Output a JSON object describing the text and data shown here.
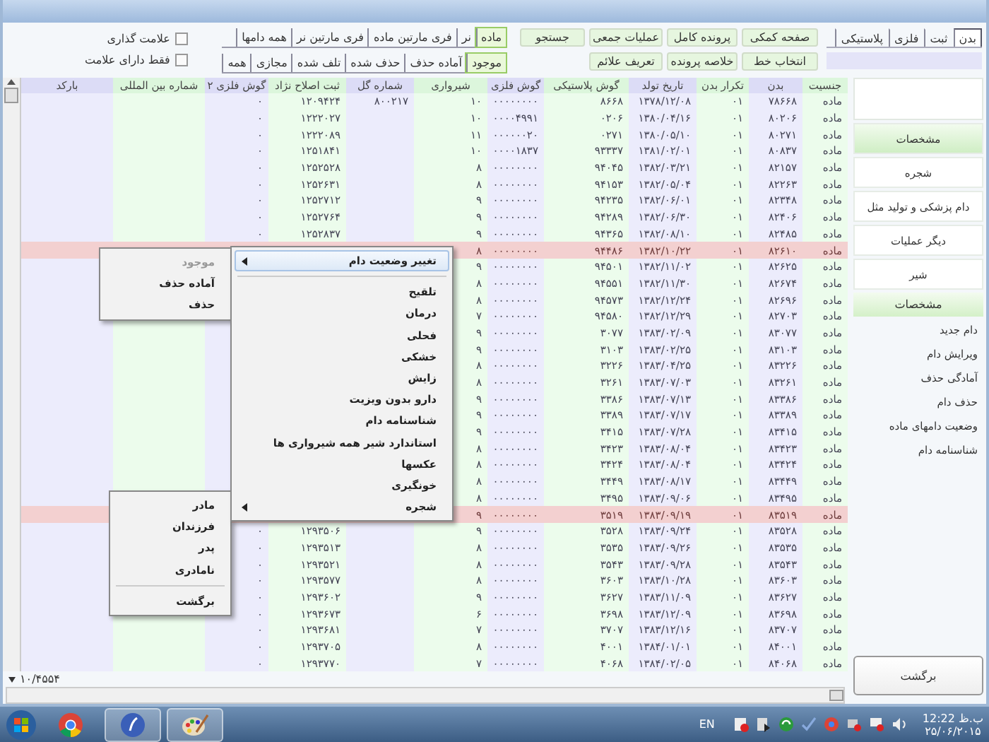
{
  "toolbar": {
    "id_tabs": [
      {
        "label": "بدن",
        "selected": true
      },
      {
        "label": "ثبت",
        "selected": false
      },
      {
        "label": "فلزی",
        "selected": false
      },
      {
        "label": "پلاستیکی",
        "selected": false
      }
    ],
    "buttons": [
      "صفحه کمکی",
      "پرونده کامل",
      "عملیات جمعی",
      "جستجو",
      "انتخاب خط",
      "خلاصه پرونده",
      "تعریف علائم"
    ],
    "sex_filter": [
      {
        "label": "ماده",
        "selected": true
      },
      {
        "label": "نر",
        "selected": false
      },
      {
        "label": "فری مارتین ماده",
        "selected": false
      },
      {
        "label": "فری مارتین نر",
        "selected": false
      },
      {
        "label": "همه دامها",
        "selected": false
      }
    ],
    "status_filter": [
      {
        "label": "موجود",
        "selected": true
      },
      {
        "label": "آماده حذف",
        "selected": false
      },
      {
        "label": "حذف شده",
        "selected": false
      },
      {
        "label": "تلف شده",
        "selected": false
      },
      {
        "label": "مجازی",
        "selected": false
      },
      {
        "label": "همه",
        "selected": false
      }
    ],
    "checkboxes": [
      {
        "label": "علامت گذاری",
        "checked": false
      },
      {
        "label": "فقط دارای علامت",
        "checked": false
      }
    ]
  },
  "table": {
    "columns": [
      "جنسیت",
      "بدن",
      "تکرار بدن",
      "تاریخ تولد",
      "گوش پلاستیکی",
      "گوش فلزی",
      "شیرواری",
      "شماره گل",
      "ثبت اصلاح نژاد",
      "گوش فلزی ۲",
      "شماره بین المللی",
      "بارکد"
    ],
    "rows": [
      {
        "selected": false,
        "sex": "ماده",
        "body": "۷۸۶۶۸",
        "repeat": "۰۱",
        "birth": "۱۳۷۸/۱۲/۰۸",
        "plastic": "۸۶۶۸",
        "metal": "۰۰۰۰۰۰۰۰",
        "milking": "۱۰",
        "herd": "۸۰۰۲۱۷",
        "register": "۱۲۰۹۴۲۴",
        "metal2": "۰"
      },
      {
        "selected": false,
        "sex": "ماده",
        "body": "۸۰۲۰۶",
        "repeat": "۰۱",
        "birth": "۱۳۸۰/۰۴/۱۶",
        "plastic": "۰۲۰۶",
        "metal": "۰۰۰۰۴۹۹۱",
        "milking": "۱۰",
        "register": "۱۲۲۲۰۲۷",
        "metal2": "۰"
      },
      {
        "selected": false,
        "sex": "ماده",
        "body": "۸۰۲۷۱",
        "repeat": "۰۱",
        "birth": "۱۳۸۰/۰۵/۱۰",
        "plastic": "۰۲۷۱",
        "metal": "۰۰۰۰۰۰۲۰",
        "milking": "۱۱",
        "register": "۱۲۲۲۰۸۹",
        "metal2": "۰"
      },
      {
        "selected": false,
        "sex": "ماده",
        "body": "۸۰۸۳۷",
        "repeat": "۰۱",
        "birth": "۱۳۸۱/۰۲/۰۱",
        "plastic": "۹۳۳۳۷",
        "metal": "۰۰۰۰۱۸۳۷",
        "milking": "۱۰",
        "register": "۱۲۵۱۸۴۱",
        "metal2": "۰"
      },
      {
        "selected": false,
        "sex": "ماده",
        "body": "۸۲۱۵۷",
        "repeat": "۰۱",
        "birth": "۱۳۸۲/۰۳/۲۱",
        "plastic": "۹۴۰۴۵",
        "metal": "۰۰۰۰۰۰۰۰",
        "milking": "۸",
        "register": "۱۲۵۲۵۲۸",
        "metal2": "۰"
      },
      {
        "selected": false,
        "sex": "ماده",
        "body": "۸۲۲۶۳",
        "repeat": "۰۱",
        "birth": "۱۳۸۲/۰۵/۰۴",
        "plastic": "۹۴۱۵۳",
        "metal": "۰۰۰۰۰۰۰۰",
        "milking": "۸",
        "register": "۱۲۵۲۶۳۱",
        "metal2": "۰"
      },
      {
        "selected": false,
        "sex": "ماده",
        "body": "۸۲۳۴۸",
        "repeat": "۰۱",
        "birth": "۱۳۸۲/۰۶/۰۱",
        "plastic": "۹۴۲۳۵",
        "metal": "۰۰۰۰۰۰۰۰",
        "milking": "۹",
        "register": "۱۲۵۲۷۱۲",
        "metal2": "۰"
      },
      {
        "selected": false,
        "sex": "ماده",
        "body": "۸۲۴۰۶",
        "repeat": "۰۱",
        "birth": "۱۳۸۲/۰۶/۳۰",
        "plastic": "۹۴۲۸۹",
        "metal": "۰۰۰۰۰۰۰۰",
        "milking": "۹",
        "register": "۱۲۵۲۷۶۴",
        "metal2": "۰"
      },
      {
        "selected": false,
        "sex": "ماده",
        "body": "۸۲۴۸۵",
        "repeat": "۰۱",
        "birth": "۱۳۸۲/۰۸/۱۰",
        "plastic": "۹۴۳۶۵",
        "metal": "۰۰۰۰۰۰۰۰",
        "milking": "۹",
        "register": "۱۲۵۲۸۳۷",
        "metal2": "۰"
      },
      {
        "selected": true,
        "sex": "ماده",
        "body": "۸۲۶۱۰",
        "repeat": "۰۱",
        "birth": "۱۳۸۲/۱۰/۲۲",
        "plastic": "۹۴۴۸۶",
        "metal": "۰۰۰۰۰۰۰۰",
        "milking": "۸"
      },
      {
        "selected": false,
        "sex": "ماده",
        "body": "۸۲۶۲۵",
        "repeat": "۰۱",
        "birth": "۱۳۸۲/۱۱/۰۲",
        "plastic": "۹۴۵۰۱",
        "metal": "۰۰۰۰۰۰۰۰",
        "milking": "۹"
      },
      {
        "selected": false,
        "sex": "ماده",
        "body": "۸۲۶۷۴",
        "repeat": "۰۱",
        "birth": "۱۳۸۲/۱۱/۳۰",
        "plastic": "۹۴۵۵۱",
        "metal": "۰۰۰۰۰۰۰۰",
        "milking": "۸"
      },
      {
        "selected": false,
        "sex": "ماده",
        "body": "۸۲۶۹۶",
        "repeat": "۰۱",
        "birth": "۱۳۸۲/۱۲/۲۴",
        "plastic": "۹۴۵۷۳",
        "metal": "۰۰۰۰۰۰۰۰",
        "milking": "۸"
      },
      {
        "selected": false,
        "sex": "ماده",
        "body": "۸۲۷۰۳",
        "repeat": "۰۱",
        "birth": "۱۳۸۲/۱۲/۲۹",
        "plastic": "۹۴۵۸۰",
        "metal": "۰۰۰۰۰۰۰۰",
        "milking": "۷"
      },
      {
        "selected": false,
        "sex": "ماده",
        "body": "۸۳۰۷۷",
        "repeat": "۰۱",
        "birth": "۱۳۸۳/۰۲/۰۹",
        "plastic": "۳۰۷۷",
        "metal": "۰۰۰۰۰۰۰۰",
        "milking": "۹"
      },
      {
        "selected": false,
        "sex": "ماده",
        "body": "۸۳۱۰۳",
        "repeat": "۰۱",
        "birth": "۱۳۸۳/۰۲/۲۵",
        "plastic": "۳۱۰۳",
        "metal": "۰۰۰۰۰۰۰۰",
        "milking": "۹"
      },
      {
        "selected": false,
        "sex": "ماده",
        "body": "۸۳۲۲۶",
        "repeat": "۰۱",
        "birth": "۱۳۸۳/۰۴/۲۵",
        "plastic": "۳۲۲۶",
        "metal": "۰۰۰۰۰۰۰۰",
        "milking": "۸"
      },
      {
        "selected": false,
        "sex": "ماده",
        "body": "۸۳۲۶۱",
        "repeat": "۰۱",
        "birth": "۱۳۸۳/۰۷/۰۳",
        "plastic": "۳۲۶۱",
        "metal": "۰۰۰۰۰۰۰۰",
        "milking": "۸"
      },
      {
        "selected": false,
        "sex": "ماده",
        "body": "۸۳۳۸۶",
        "repeat": "۰۱",
        "birth": "۱۳۸۳/۰۷/۱۳",
        "plastic": "۳۳۸۶",
        "metal": "۰۰۰۰۰۰۰۰",
        "milking": "۹"
      },
      {
        "selected": false,
        "sex": "ماده",
        "body": "۸۳۳۸۹",
        "repeat": "۰۱",
        "birth": "۱۳۸۳/۰۷/۱۷",
        "plastic": "۳۳۸۹",
        "metal": "۰۰۰۰۰۰۰۰",
        "milking": "۹"
      },
      {
        "selected": false,
        "sex": "ماده",
        "body": "۸۳۴۱۵",
        "repeat": "۰۱",
        "birth": "۱۳۸۳/۰۷/۲۸",
        "plastic": "۳۴۱۵",
        "metal": "۰۰۰۰۰۰۰۰",
        "milking": "۹"
      },
      {
        "selected": false,
        "sex": "ماده",
        "body": "۸۳۴۲۳",
        "repeat": "۰۱",
        "birth": "۱۳۸۳/۰۸/۰۴",
        "plastic": "۳۴۲۳",
        "metal": "۰۰۰۰۰۰۰۰",
        "milking": "۸"
      },
      {
        "selected": false,
        "sex": "ماده",
        "body": "۸۳۴۲۴",
        "repeat": "۰۱",
        "birth": "۱۳۸۳/۰۸/۰۴",
        "plastic": "۳۴۲۴",
        "metal": "۰۰۰۰۰۰۰۰",
        "milking": "۸"
      },
      {
        "selected": false,
        "sex": "ماده",
        "body": "۸۳۴۴۹",
        "repeat": "۰۱",
        "birth": "۱۳۸۳/۰۸/۱۷",
        "plastic": "۳۴۴۹",
        "metal": "۰۰۰۰۰۰۰۰",
        "milking": "۸"
      },
      {
        "selected": false,
        "sex": "ماده",
        "body": "۸۳۴۹۵",
        "repeat": "۰۱",
        "birth": "۱۳۸۳/۰۹/۰۶",
        "plastic": "۳۴۹۵",
        "metal": "۰۰۰۰۰۰۰۰",
        "milking": "۸"
      },
      {
        "selected": true,
        "sex": "ماده",
        "body": "۸۳۵۱۹",
        "repeat": "۰۱",
        "birth": "۱۳۸۳/۰۹/۱۹",
        "plastic": "۳۵۱۹",
        "metal": "۰۰۰۰۰۰۰۰",
        "milking": "۹"
      },
      {
        "selected": false,
        "sex": "ماده",
        "body": "۸۳۵۲۸",
        "repeat": "۰۱",
        "birth": "۱۳۸۳/۰۹/۲۴",
        "plastic": "۳۵۲۸",
        "metal": "۰۰۰۰۰۰۰۰",
        "milking": "۹",
        "register": "۱۲۹۳۵۰۶",
        "metal2": "۰"
      },
      {
        "selected": false,
        "sex": "ماده",
        "body": "۸۳۵۳۵",
        "repeat": "۰۱",
        "birth": "۱۳۸۳/۰۹/۲۶",
        "plastic": "۳۵۳۵",
        "metal": "۰۰۰۰۰۰۰۰",
        "milking": "۸",
        "register": "۱۲۹۳۵۱۳",
        "metal2": "۰"
      },
      {
        "selected": false,
        "sex": "ماده",
        "body": "۸۳۵۴۳",
        "repeat": "۰۱",
        "birth": "۱۳۸۳/۰۹/۲۸",
        "plastic": "۳۵۴۳",
        "metal": "۰۰۰۰۰۰۰۰",
        "milking": "۸",
        "register": "۱۲۹۳۵۲۱",
        "metal2": "۰"
      },
      {
        "selected": false,
        "sex": "ماده",
        "body": "۸۳۶۰۳",
        "repeat": "۰۱",
        "birth": "۱۳۸۳/۱۰/۲۸",
        "plastic": "۳۶۰۳",
        "metal": "۰۰۰۰۰۰۰۰",
        "milking": "۸",
        "register": "۱۲۹۳۵۷۷",
        "metal2": "۰"
      },
      {
        "selected": false,
        "sex": "ماده",
        "body": "۸۳۶۲۷",
        "repeat": "۰۱",
        "birth": "۱۳۸۳/۱۱/۰۹",
        "plastic": "۳۶۲۷",
        "metal": "۰۰۰۰۰۰۰۰",
        "milking": "۹",
        "register": "۱۲۹۳۶۰۲",
        "metal2": "۰"
      },
      {
        "selected": false,
        "sex": "ماده",
        "body": "۸۳۶۹۸",
        "repeat": "۰۱",
        "birth": "۱۳۸۳/۱۲/۰۹",
        "plastic": "۳۶۹۸",
        "metal": "۰۰۰۰۰۰۰۰",
        "milking": "۶",
        "register": "۱۲۹۳۶۷۳",
        "metal2": "۰"
      },
      {
        "selected": false,
        "sex": "ماده",
        "body": "۸۳۷۰۷",
        "repeat": "۰۱",
        "birth": "۱۳۸۳/۱۲/۱۶",
        "plastic": "۳۷۰۷",
        "metal": "۰۰۰۰۰۰۰۰",
        "milking": "۷",
        "register": "۱۲۹۳۶۸۱",
        "metal2": "۰"
      },
      {
        "selected": false,
        "sex": "ماده",
        "body": "۸۴۰۰۱",
        "repeat": "۰۱",
        "birth": "۱۳۸۴/۰۱/۰۱",
        "plastic": "۴۰۰۱",
        "metal": "۰۰۰۰۰۰۰۰",
        "milking": "۸",
        "register": "۱۲۹۳۷۰۵",
        "metal2": "۰"
      },
      {
        "selected": false,
        "sex": "ماده",
        "body": "۸۴۰۶۸",
        "repeat": "۰۱",
        "birth": "۱۳۸۴/۰۲/۰۵",
        "plastic": "۴۰۶۸",
        "metal": "۰۰۰۰۰۰۰۰",
        "milking": "۷",
        "register": "۱۲۹۳۷۷۰",
        "metal2": "۰"
      }
    ],
    "record_count": "۱۰/۴۵۵۴"
  },
  "context_menu": {
    "items": [
      {
        "kind": "submenu",
        "label": "تغییر وضعیت دام",
        "highlighted": true
      },
      {
        "kind": "separator"
      },
      {
        "kind": "item",
        "label": "تلقیح",
        "highlighted": false
      },
      {
        "kind": "item",
        "label": "درمان",
        "highlighted": false
      },
      {
        "kind": "item",
        "label": "فحلی",
        "highlighted": false
      },
      {
        "kind": "item",
        "label": "خشکی",
        "highlighted": false
      },
      {
        "kind": "item",
        "label": "زایش",
        "highlighted": false
      },
      {
        "kind": "item",
        "label": "دارو بدون ویزیت",
        "highlighted": false
      },
      {
        "kind": "item",
        "label": "شناسنامه دام",
        "highlighted": false
      },
      {
        "kind": "item",
        "label": "استاندارد شیر همه شیرواری ها",
        "highlighted": false
      },
      {
        "kind": "item",
        "label": "عکسها",
        "highlighted": false
      },
      {
        "kind": "item",
        "label": "خونگیری",
        "highlighted": false
      },
      {
        "kind": "submenu",
        "label": "شجره",
        "highlighted": false
      }
    ]
  },
  "status_submenu": {
    "items": [
      {
        "label": "موجود",
        "disabled": true
      },
      {
        "label": "آماده حذف",
        "disabled": false
      },
      {
        "label": "حذف",
        "disabled": false
      }
    ]
  },
  "family_submenu": {
    "items": [
      {
        "kind": "item",
        "label": "مادر"
      },
      {
        "kind": "item",
        "label": "فرزندان"
      },
      {
        "kind": "item",
        "label": "پدر"
      },
      {
        "kind": "item",
        "label": "نامادری"
      },
      {
        "kind": "separator"
      },
      {
        "kind": "item",
        "label": "برگشت"
      }
    ]
  },
  "sidebar": {
    "buttons": [
      {
        "label": "مشخصات",
        "selected": true
      },
      {
        "label": "شجره",
        "selected": false
      },
      {
        "label": "دام پزشکی و تولید مثل",
        "selected": false
      },
      {
        "label": "دیگر عملیات",
        "selected": false
      },
      {
        "label": "شیر",
        "selected": false
      }
    ],
    "section": {
      "title": "مشخصات",
      "items": [
        "دام جدید",
        "ویرایش دام",
        "آمادگی حذف",
        "حذف دام",
        "وضعیت دامهای ماده",
        "شناسنامه دام"
      ]
    },
    "back_button": "برگشت"
  },
  "taskbar": {
    "apps": [
      {
        "kind": "browser",
        "active": false
      },
      {
        "kind": "app",
        "active": true
      },
      {
        "kind": "paint",
        "active": true
      }
    ],
    "language": "EN",
    "time": "ب.ظ 12:22",
    "date": "۲۵/۰۶/۲۰۱۵"
  }
}
